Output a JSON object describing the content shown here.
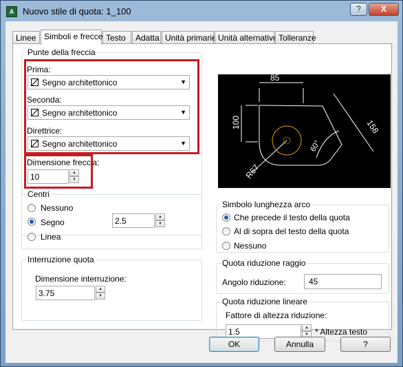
{
  "window": {
    "title": "Nuovo stile di quota: 1_100",
    "help_label": "?",
    "close_label": "X"
  },
  "tabs": [
    {
      "label": "Linee"
    },
    {
      "label": "Simboli e frecce"
    },
    {
      "label": "Testo"
    },
    {
      "label": "Adatta"
    },
    {
      "label": "Unità primarie"
    },
    {
      "label": "Unità alternative"
    },
    {
      "label": "Tolleranze"
    }
  ],
  "arrowheads": {
    "title": "Punte della freccia",
    "first_label": "Prima:",
    "first_value": "Segno architettonico",
    "second_label": "Seconda:",
    "second_value": "Segno architettonico",
    "leader_label": "Direttrice:",
    "leader_value": "Segno architettonico",
    "size_label": "Dimensione freccia:",
    "size_value": "10"
  },
  "centers": {
    "title": "Centri",
    "options": [
      "Nessuno",
      "Segno",
      "Linea"
    ],
    "selected": "Segno",
    "size_value": "2.5"
  },
  "break": {
    "title": "Interruzione quota",
    "size_label": "Dimensione interruzione:",
    "size_value": "3.75"
  },
  "preview": {
    "dim_85": "85",
    "dim_100": "100",
    "dim_158": "158",
    "dim_60": "60°",
    "dim_r67": "R67"
  },
  "arc_symbol": {
    "title": "Simbolo lunghezza arco",
    "options": [
      "Che precede il testo della quota",
      "Al di sopra del testo della quota",
      "Nessuno"
    ],
    "selected": "Che precede il testo della quota"
  },
  "radius_jog": {
    "title": "Quota riduzione raggio",
    "angle_label": "Angolo riduzione:",
    "angle_value": "45"
  },
  "linear_jog": {
    "title": "Quota riduzione lineare",
    "factor_label": "Fattore di altezza riduzione:",
    "factor_value": "1.5",
    "suffix": "* Altezza testo"
  },
  "buttons": {
    "ok": "OK",
    "cancel": "Annulla",
    "help": "?"
  },
  "colors": {
    "highlight_box": "#c61b22",
    "preview_lines": "#ffffff",
    "preview_circle": "#e0a000",
    "preview_bg": "#000000"
  }
}
